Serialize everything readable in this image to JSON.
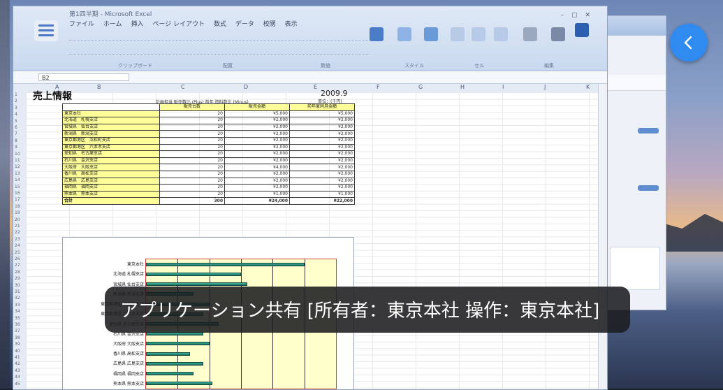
{
  "sheet": {
    "title": "売上情報",
    "year": "2009.9",
    "unit": "単位：(千円)",
    "note": "計画担当 販売数比 (Plus)   前年 資料数比 (Minus)",
    "name_box": "B2",
    "columns": [
      "",
      "販売台数",
      "販売金額",
      "前年度同月金額"
    ],
    "rows": [
      {
        "name": "東京本社",
        "a": "20",
        "b": "¥5,000",
        "c": "¥5,000"
      },
      {
        "name": "北海道　札幌支店",
        "a": "20",
        "b": "¥2,000",
        "c": "¥2,000"
      },
      {
        "name": "宮城県　仙台支店",
        "a": "20",
        "b": "¥2,000",
        "c": "¥2,000"
      },
      {
        "name": "新潟県　新潟支店",
        "a": "20",
        "b": "¥2,000",
        "c": "¥2,000"
      },
      {
        "name": "東京都港区　浜松町支店",
        "a": "20",
        "b": "¥2,000",
        "c": "¥2,000"
      },
      {
        "name": "東京都港区　六本木支店",
        "a": "20",
        "b": "¥2,000",
        "c": "¥2,000"
      },
      {
        "name": "愛知県　名古屋支店",
        "a": "20",
        "b": "¥2,000",
        "c": "¥2,000"
      },
      {
        "name": "石川県　金沢支店",
        "a": "20",
        "b": "¥2,000",
        "c": "¥2,000"
      },
      {
        "name": "大阪府　大阪支店",
        "a": "20",
        "b": "¥4,000",
        "c": "¥2,000"
      },
      {
        "name": "香川県　高松支店",
        "a": "20",
        "b": "¥2,000",
        "c": "¥2,000"
      },
      {
        "name": "広島県　広島支店",
        "a": "20",
        "b": "¥2,000",
        "c": "¥2,000"
      },
      {
        "name": "福岡県　福岡支店",
        "a": "20",
        "b": "¥2,000",
        "c": "¥2,000"
      },
      {
        "name": "熊本県　熊本支店",
        "a": "20",
        "b": "¥1,000",
        "c": "¥1,000"
      }
    ],
    "total": {
      "name": "合計",
      "a": "300",
      "b": "¥24,000",
      "c": "¥22,000"
    }
  },
  "ribbon": {
    "title": "第1四半期 - Microsoft Excel",
    "menu": [
      "ファイル",
      "ホーム",
      "挿入",
      "ページ レイアウト",
      "数式",
      "データ",
      "校閲",
      "表示"
    ],
    "groups": [
      "クリップボード",
      "フォント",
      "配置",
      "数値",
      "スタイル",
      "セル",
      "編集"
    ]
  },
  "chart_data": {
    "type": "bar",
    "orientation": "horizontal",
    "categories": [
      "東京本社",
      "北海道 札幌支店",
      "宮城県 仙台支店",
      "新潟県 新潟支店",
      "東京都港区 浜松町支店",
      "東京都港区 六本木支店",
      "愛知県 名古屋支店",
      "石川県 金沢支店",
      "大阪府 大阪支店",
      "香川県 高松支店",
      "広島県 広島支店",
      "福岡県 福岡支店",
      "熊本県 熊本支店"
    ],
    "values": [
      5000,
      3000,
      3200,
      1500,
      2000,
      1800,
      2300,
      1800,
      2000,
      1400,
      1800,
      1500,
      2100
    ],
    "xlim": [
      0,
      6000
    ],
    "grid": true,
    "colors": {
      "bar": "#2aa88e",
      "plot_bg": "#ffffcc",
      "plot_border": "#d14040"
    }
  },
  "caption": {
    "text": "アプリケーション共有 [所有者：東京本社 操作：東京本社]"
  },
  "colors": {
    "accent": "#2f8bf0",
    "caption_bg": "#1c1c20"
  },
  "icons": {
    "menu": "hamburger-icon",
    "back": "chevron-left-icon"
  }
}
